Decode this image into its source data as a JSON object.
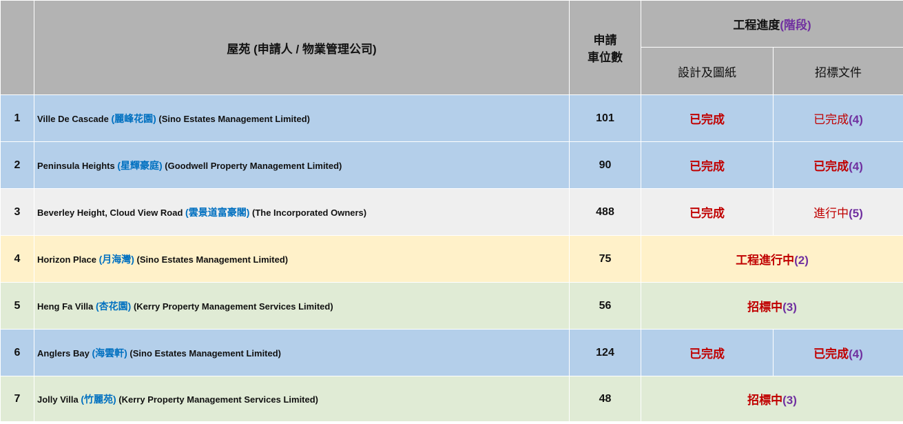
{
  "header": {
    "estate_label": "屋苑 (申請人 / 物業管理公司)",
    "count_label_line1": "申請",
    "count_label_line2": "車位數",
    "progress_label": "工程進度",
    "progress_stage_label": "(階段)",
    "design_label": "設計及圖紙",
    "tender_label": "招標文件"
  },
  "rows": [
    {
      "no": "1",
      "name_en": "Ville De Cascade ",
      "name_zh": "(麗峰花園)",
      "manager": " (Sino Estates Management Limited)",
      "count": "101",
      "design_status": "已完成",
      "tender_status": "已完成",
      "tender_stage": "(4)"
    },
    {
      "no": "2",
      "name_en": "Peninsula Heights ",
      "name_zh": "(星輝豪庭)",
      "manager": " (Goodwell Property Management Limited)",
      "count": "90",
      "design_status": "已完成",
      "tender_status": "已完成",
      "tender_stage": "(4)"
    },
    {
      "no": "3",
      "name_en": "Beverley Height, Cloud View Road ",
      "name_zh": "(雲景道富豪閣)",
      "manager": " (The Incorporated Owners)",
      "count": "488",
      "design_status": "已完成",
      "tender_status": "進行中",
      "tender_stage": "(5)"
    },
    {
      "no": "4",
      "name_en": "Horizon Place ",
      "name_zh": "(月海灣)",
      "manager": " (Sino Estates Management Limited)",
      "count": "75",
      "merged_status": "工程進行中",
      "merged_stage": "(2)"
    },
    {
      "no": "5",
      "name_en": "Heng Fa Villa ",
      "name_zh": "(杏花園)",
      "manager": " (Kerry Property Management Services Limited)",
      "count": "56",
      "merged_status": "招標中",
      "merged_stage": "(3)"
    },
    {
      "no": "6",
      "name_en": "Anglers Bay ",
      "name_zh": "(海雲軒)",
      "manager": " (Sino Estates Management Limited)",
      "count": "124",
      "design_status": "已完成",
      "tender_status": "已完成",
      "tender_stage": "(4)"
    },
    {
      "no": "7",
      "name_en": "Jolly Villa ",
      "name_zh": "(竹麗苑)",
      "manager": " (Kerry Property Management Services Limited)",
      "count": "48",
      "merged_status": "招標中",
      "merged_stage": "(3)"
    }
  ],
  "colors": {
    "header_bg": "#b3b3b3",
    "blue_row": "#b4cfea",
    "grey_row": "#efefef",
    "yellow_row": "#fff1c9",
    "green_row": "#e0ebd5",
    "status_red": "#c00000",
    "stage_purple": "#7030a0",
    "chinese_name_blue": "#0070c0"
  }
}
